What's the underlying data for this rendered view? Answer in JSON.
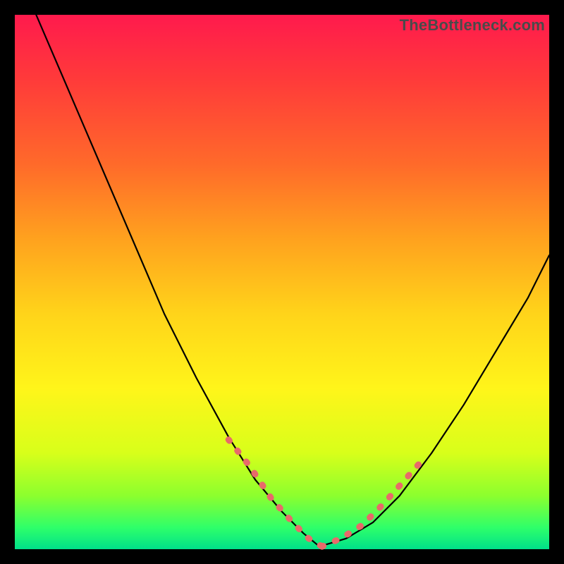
{
  "watermark": "TheBottleneck.com",
  "chart_data": {
    "type": "line",
    "title": "",
    "xlabel": "",
    "ylabel": "",
    "ylim": [
      0,
      100
    ],
    "series": [
      {
        "name": "curve-left",
        "x": [
          0.04,
          0.1,
          0.16,
          0.22,
          0.28,
          0.34,
          0.4,
          0.45,
          0.5,
          0.54,
          0.57
        ],
        "y": [
          1.0,
          0.86,
          0.72,
          0.58,
          0.44,
          0.32,
          0.21,
          0.13,
          0.07,
          0.03,
          0.005
        ],
        "stroke": "#000000",
        "width": 2.2
      },
      {
        "name": "curve-right",
        "x": [
          0.57,
          0.62,
          0.67,
          0.72,
          0.78,
          0.84,
          0.9,
          0.96,
          1.0
        ],
        "y": [
          0.005,
          0.02,
          0.05,
          0.1,
          0.18,
          0.27,
          0.37,
          0.47,
          0.55
        ],
        "stroke": "#000000",
        "width": 2.2
      },
      {
        "name": "highlight-left",
        "x": [
          0.4,
          0.44,
          0.48,
          0.52,
          0.55,
          0.575
        ],
        "y": [
          0.205,
          0.155,
          0.095,
          0.05,
          0.02,
          0.005
        ],
        "stroke": "#e86a6a",
        "width": 9,
        "dash": "2 18"
      },
      {
        "name": "highlight-right",
        "x": [
          0.575,
          0.61,
          0.65,
          0.69,
          0.73,
          0.77
        ],
        "y": [
          0.005,
          0.02,
          0.045,
          0.085,
          0.13,
          0.175
        ],
        "stroke": "#e86a6a",
        "width": 9,
        "dash": "2 18"
      }
    ],
    "gradient_stops": [
      {
        "pos": 0.0,
        "color": "#ff1a4d"
      },
      {
        "pos": 0.12,
        "color": "#ff3a3a"
      },
      {
        "pos": 0.28,
        "color": "#ff6a2a"
      },
      {
        "pos": 0.42,
        "color": "#ffa21e"
      },
      {
        "pos": 0.56,
        "color": "#ffd41a"
      },
      {
        "pos": 0.7,
        "color": "#fff51a"
      },
      {
        "pos": 0.82,
        "color": "#d8ff1a"
      },
      {
        "pos": 0.9,
        "color": "#8cff2e"
      },
      {
        "pos": 0.96,
        "color": "#2eff6a"
      },
      {
        "pos": 1.0,
        "color": "#00e08a"
      }
    ]
  }
}
